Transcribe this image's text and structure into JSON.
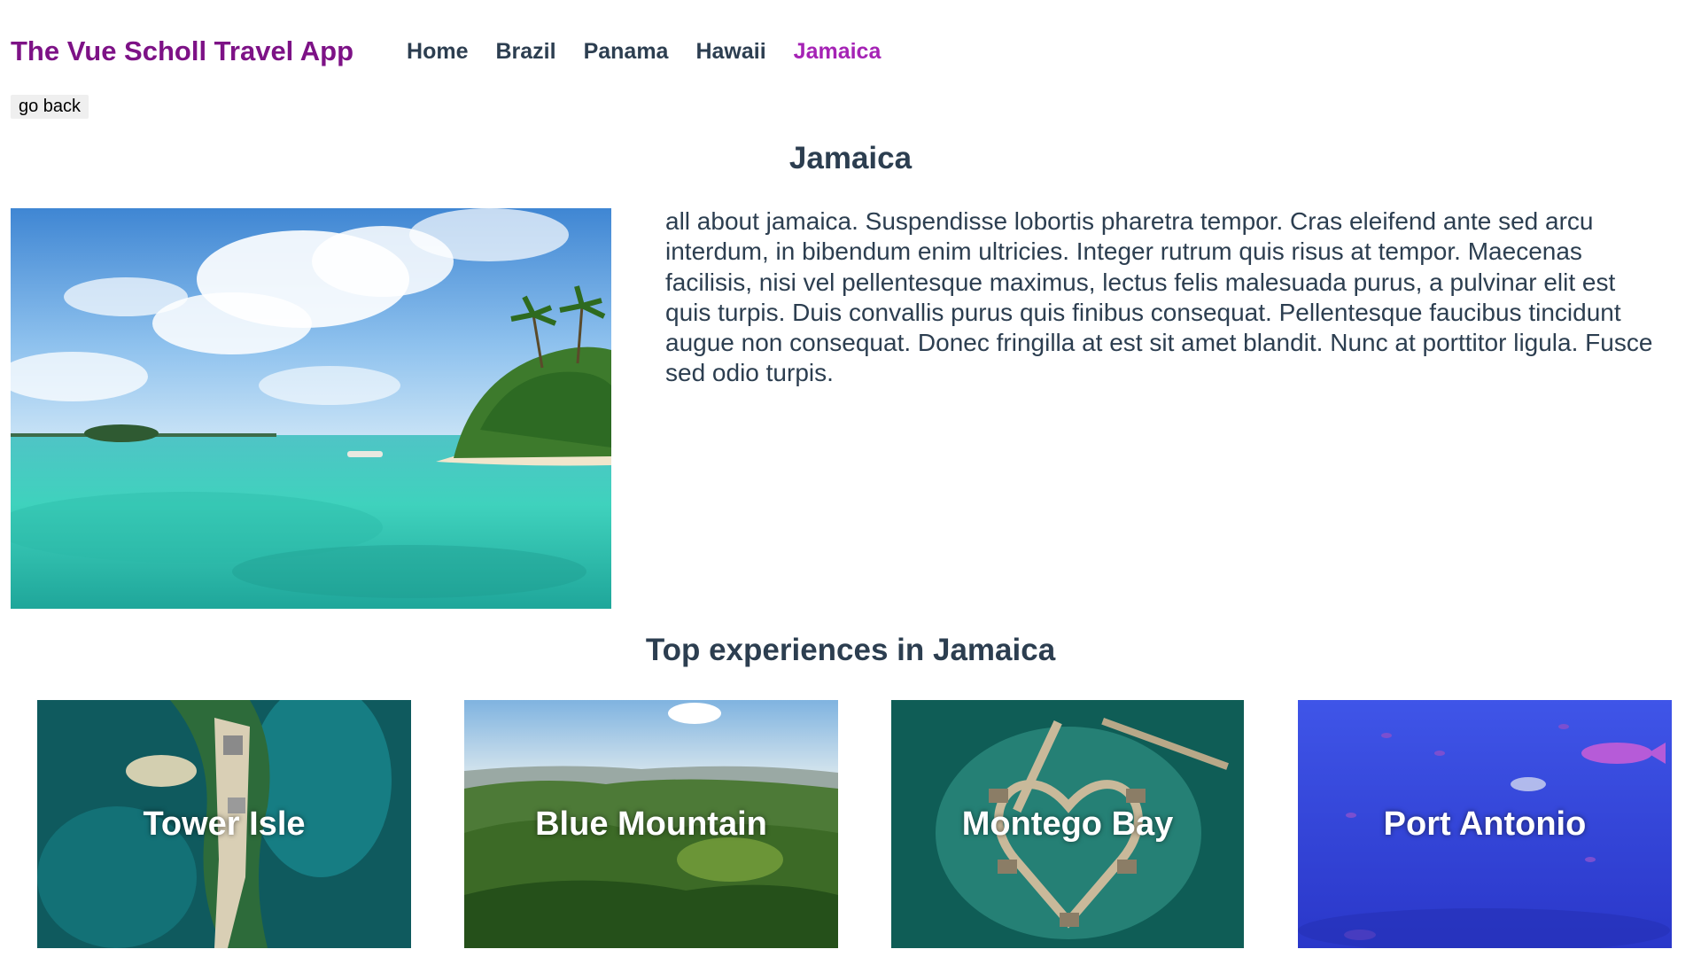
{
  "header": {
    "brand": "The Vue Scholl Travel App",
    "nav": [
      {
        "label": "Home",
        "active": false
      },
      {
        "label": "Brazil",
        "active": false
      },
      {
        "label": "Panama",
        "active": false
      },
      {
        "label": "Hawaii",
        "active": false
      },
      {
        "label": "Jamaica",
        "active": true
      }
    ]
  },
  "go_back_label": "go back",
  "destination": {
    "name": "Jamaica",
    "description": "all about jamaica. Suspendisse lobortis pharetra tempor. Cras eleifend ante sed arcu interdum, in bibendum enim ultricies. Integer rutrum quis risus at tempor. Maecenas facilisis, nisi vel pellentesque maximus, lectus felis malesuada purus, a pulvinar elit est quis turpis. Duis convallis purus quis finibus consequat. Pellentesque faucibus tincidunt augue non consequat. Donec fringilla at est sit amet blandit. Nunc at porttitor ligula. Fusce sed odio turpis."
  },
  "experiences": {
    "title": "Top experiences in Jamaica",
    "items": [
      {
        "name": "Tower Isle"
      },
      {
        "name": "Blue Mountain"
      },
      {
        "name": "Montego Bay"
      },
      {
        "name": "Port Antonio"
      }
    ]
  },
  "colors": {
    "brand": "#7d1286",
    "active_link": "#a523b5",
    "text": "#2c3e50"
  }
}
